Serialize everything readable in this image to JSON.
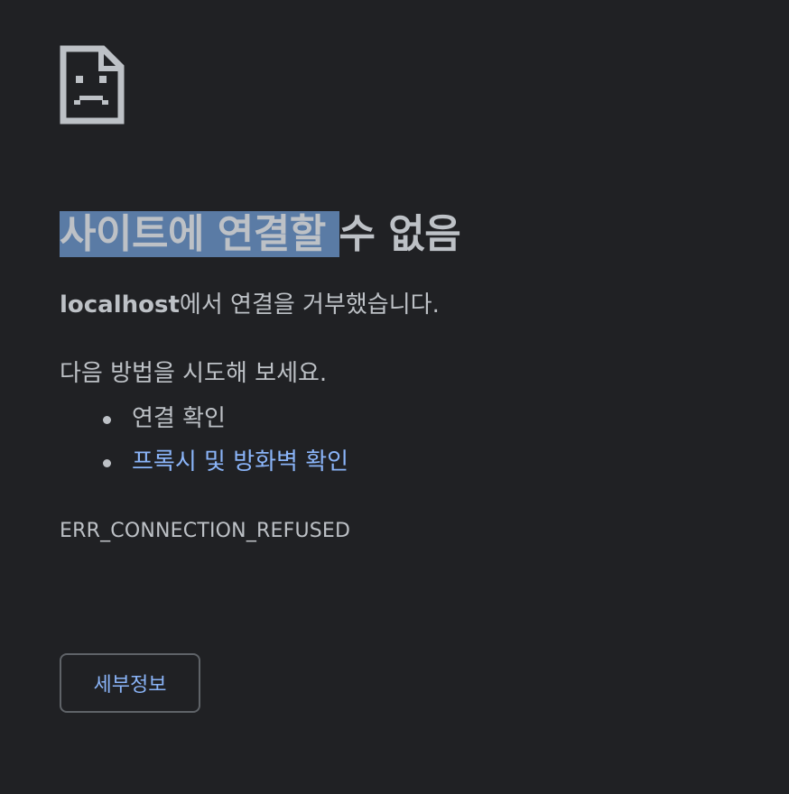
{
  "error_page": {
    "icon": "sad-page-icon",
    "title_selected": "사이트에 연결할 ",
    "title_rest": "수 없음",
    "description_host": "localhost",
    "description_rest": "에서 연결을 거부했습니다.",
    "suggestions_intro": "다음 방법을 시도해 보세요.",
    "suggestions": [
      {
        "label": "연결 확인",
        "link": false
      },
      {
        "label": "프록시 및 방화벽 확인",
        "link": true
      }
    ],
    "error_code": "ERR_CONNECTION_REFUSED",
    "details_button": "세부정보"
  },
  "colors": {
    "background": "#202124",
    "text": "#bdc1c6",
    "link": "#8ab4f8",
    "selection": "#5a7ba5",
    "button_border": "#5f6368"
  }
}
